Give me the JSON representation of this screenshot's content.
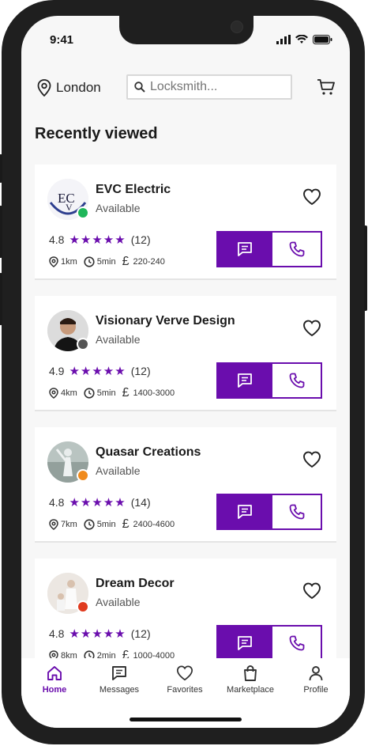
{
  "status": {
    "time": "9:41"
  },
  "header": {
    "location": "London",
    "search_placeholder": "Locksmith..."
  },
  "section_title": "Recently viewed",
  "providers": [
    {
      "name": "EVC Electric",
      "status": "Available",
      "status_color": "#1fb65a",
      "rating": "4.8",
      "stars": "★★★★★",
      "reviews": "(12)",
      "distance": "1km",
      "time": "5min",
      "price": "220-240",
      "avatar": "EVC logo"
    },
    {
      "name": "Visionary Verve Design",
      "status": "Available",
      "status_color": "#555555",
      "rating": "4.9",
      "stars": "★★★★★",
      "reviews": "(12)",
      "distance": "4km",
      "time": "5min",
      "price": "1400-3000",
      "avatar": "portrait photo"
    },
    {
      "name": "Quasar Creations",
      "status": "Available",
      "status_color": "#f08a1c",
      "rating": "4.8",
      "stars": "★★★★★",
      "reviews": "(14)",
      "distance": "7km",
      "time": "5min",
      "price": "2400-4600",
      "avatar": "statue photo"
    },
    {
      "name": "Dream Decor",
      "status": "Available",
      "status_color": "#e03a1e",
      "rating": "4.8",
      "stars": "★★★★★",
      "reviews": "(12)",
      "distance": "8km",
      "time": "2min",
      "price": "1000-4000",
      "avatar": "interior photo"
    }
  ],
  "tabs": [
    {
      "label": "Home",
      "icon": "home-icon"
    },
    {
      "label": "Messages",
      "icon": "message-icon"
    },
    {
      "label": "Favorites",
      "icon": "heart-icon"
    },
    {
      "label": "Marketplace",
      "icon": "bag-icon"
    },
    {
      "label": "Profile",
      "icon": "person-icon"
    }
  ],
  "colors": {
    "accent": "#6a0dad",
    "background": "#f7f7f7"
  }
}
